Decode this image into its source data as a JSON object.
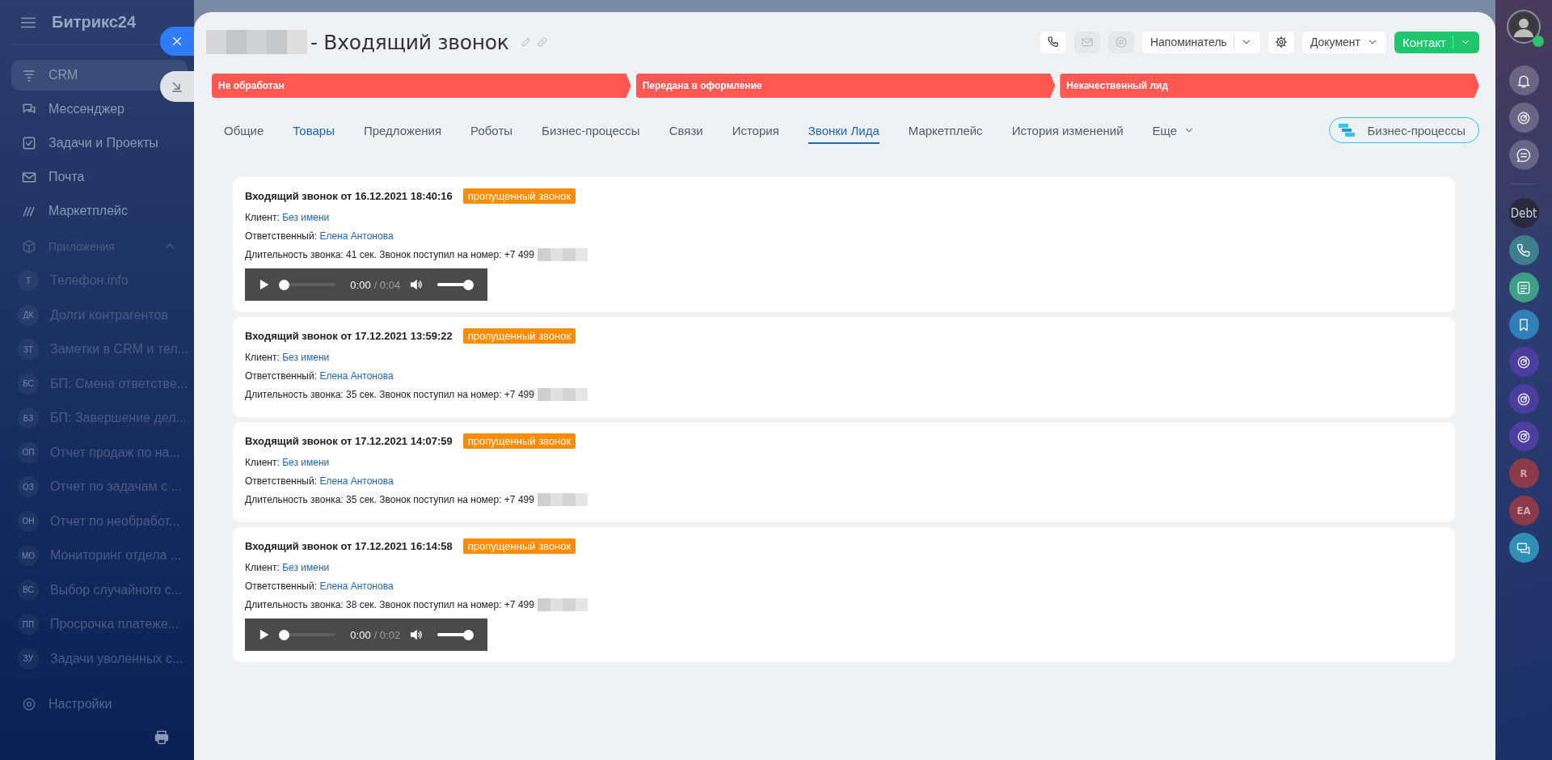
{
  "sidebar": {
    "logo": "Битрикс24",
    "menu": [
      {
        "kind": "crm",
        "label": "CRM",
        "selected": true
      },
      {
        "kind": "messenger",
        "label": "Мессенджер",
        "selected": false
      },
      {
        "kind": "tasks",
        "label": "Задачи и Проекты",
        "selected": false
      },
      {
        "kind": "mail",
        "label": "Почта",
        "selected": false
      },
      {
        "kind": "market",
        "label": "Маркетплейс",
        "selected": false
      }
    ],
    "apps_header": "Приложения",
    "apps": [
      {
        "initials": "Т",
        "label": "Телефон.info"
      },
      {
        "initials": "ДК",
        "label": "Долги контрагентов"
      },
      {
        "initials": "ЗТ",
        "label": "Заметки в CRM и тел..."
      },
      {
        "initials": "БС",
        "label": "БП: Смена ответстве..."
      },
      {
        "initials": "БЗ",
        "label": "БП: Завершение дел..."
      },
      {
        "initials": "ОП",
        "label": "Отчет продаж по на..."
      },
      {
        "initials": "ОЗ",
        "label": "Отчет по задачам с ..."
      },
      {
        "initials": "ОН",
        "label": "Отчет по необработ..."
      },
      {
        "initials": "МО",
        "label": "Мониторинг отдела ..."
      },
      {
        "initials": "ВС",
        "label": "Выбор случайного с..."
      },
      {
        "initials": "ПП",
        "label": "Просрочка платеже..."
      },
      {
        "initials": "ЗУ",
        "label": "Задачи уволенных с..."
      }
    ],
    "settings": "Настройки"
  },
  "title": "- Входящий звонок",
  "actions": [
    {
      "kind": "call",
      "disabled": false
    },
    {
      "kind": "mail",
      "disabled": true
    },
    {
      "kind": "chat",
      "disabled": true
    },
    {
      "kind": "split",
      "label": "Напоминатель",
      "disabled": false
    },
    {
      "kind": "settings",
      "disabled": false
    },
    {
      "kind": "dropdown",
      "label": "Документ",
      "disabled": false
    },
    {
      "kind": "primary",
      "label": "Контакт",
      "disabled": false
    }
  ],
  "stages": [
    "Не обработан",
    "Передана в оформление",
    "Некачественный лид"
  ],
  "tabs": [
    {
      "kind": "tab",
      "label": "Общие",
      "selected": false,
      "highlighted": false
    },
    {
      "kind": "tab",
      "label": "Товары",
      "selected": false,
      "highlighted": true
    },
    {
      "kind": "tab",
      "label": "Предложения",
      "selected": false,
      "highlighted": false
    },
    {
      "kind": "tab",
      "label": "Роботы",
      "selected": false,
      "highlighted": false
    },
    {
      "kind": "tab",
      "label": "Бизнес-процессы",
      "selected": false,
      "highlighted": false
    },
    {
      "kind": "tab",
      "label": "Связи",
      "selected": false,
      "highlighted": false
    },
    {
      "kind": "tab",
      "label": "История",
      "selected": false,
      "highlighted": false
    },
    {
      "kind": "tab",
      "label": "Звонки Лида",
      "selected": true,
      "highlighted": false
    },
    {
      "kind": "tab",
      "label": "Маркетплейс",
      "selected": false,
      "highlighted": false
    },
    {
      "kind": "tab",
      "label": "История изменений",
      "selected": false,
      "highlighted": false
    },
    {
      "kind": "more",
      "label": "Еще",
      "selected": false,
      "highlighted": false
    }
  ],
  "bp_button": "Бизнес-процессы",
  "calls": [
    {
      "title": "Входящий звонок от 16.12.2021 18:40:16",
      "badge": "пропущенный звонок",
      "client_label": "Клиент:",
      "client": "Без имени",
      "responsible_label": "Ответственный:",
      "responsible": "Елена Антонова",
      "duration": "Длительность звонка: 41 сек. Звонок поступил на номер: +7 499",
      "player": {
        "time": "0:00",
        "duration": "/ 0:04",
        "progress": {
          "level": 0
        },
        "volume": {
          "level": 1
        }
      }
    },
    {
      "title": "Входящий звонок от 17.12.2021 13:59:22",
      "badge": "пропущенный звонок",
      "client_label": "Клиент:",
      "client": "Без имени",
      "responsible_label": "Ответственный:",
      "responsible": "Елена Антонова",
      "duration": "Длительность звонка: 35 сек. Звонок поступил на номер: +7 499"
    },
    {
      "title": "Входящий звонок от 17.12.2021 14:07:59",
      "badge": "пропущенный звонок",
      "client_label": "Клиент:",
      "client": "Без имени",
      "responsible_label": "Ответственный:",
      "responsible": "Елена Антонова",
      "duration": "Длительность звонка: 35 сек. Звонок поступил на номер: +7 499"
    },
    {
      "title": "Входящий звонок от 17.12.2021 16:14:58",
      "badge": "пропущенный звонок",
      "client_label": "Клиент:",
      "client": "Без имени",
      "responsible_label": "Ответственный:",
      "responsible": "Елена Антонова",
      "duration": "Длительность звонка: 38 сек. Звонок поступил на номер: +7 499",
      "player": {
        "time": "0:00",
        "duration": "/ 0:02",
        "progress": {
          "level": 0
        },
        "volume": {
          "level": 1
        }
      }
    }
  ],
  "right_bar": [
    {
      "kind": "avatar"
    },
    {
      "kind": "bell"
    },
    {
      "kind": "copilot"
    },
    {
      "kind": "chat"
    },
    {
      "kind": "divider"
    },
    {
      "kind": "text",
      "text": "Debt"
    },
    {
      "kind": "phone-app"
    },
    {
      "kind": "news-app"
    },
    {
      "kind": "bookmark-app"
    },
    {
      "kind": "copilot-app"
    },
    {
      "kind": "copilot-app"
    },
    {
      "kind": "copilot-app"
    },
    {
      "kind": "initials",
      "text": "R"
    },
    {
      "kind": "initials",
      "text": "EA"
    },
    {
      "kind": "chat-app"
    }
  ]
}
